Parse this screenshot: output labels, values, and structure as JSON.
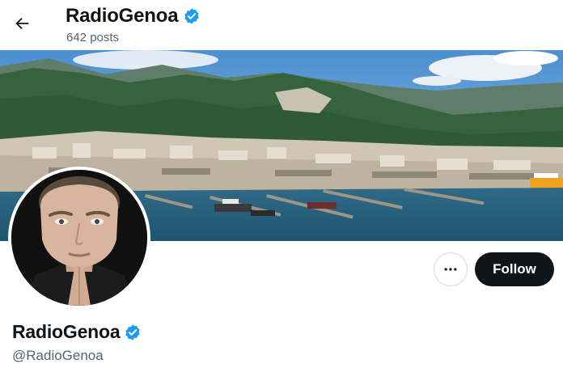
{
  "header": {
    "back_icon": "arrow-left-icon",
    "title": "RadioGenoa",
    "posts_count": "642 posts"
  },
  "banner": {
    "description_icon": "banner-image"
  },
  "profile": {
    "display_name": "RadioGenoa",
    "handle": "@RadioGenoa",
    "verified": true,
    "verified_color": "#1d9bf0"
  },
  "actions": {
    "more_icon": "more-horizontal-icon",
    "follow_label": "Follow"
  }
}
